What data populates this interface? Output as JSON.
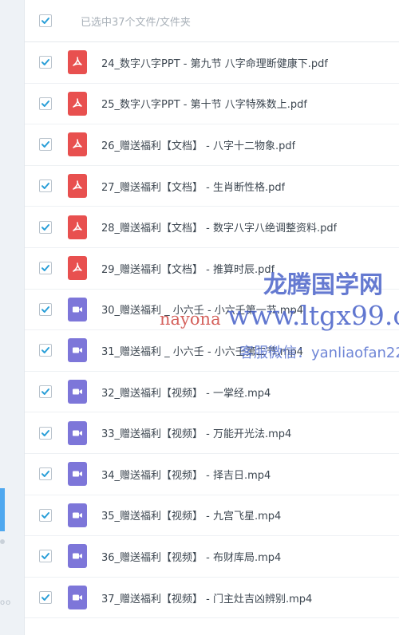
{
  "header": {
    "selection_text": "已选中37个文件/文件夹"
  },
  "files": [
    {
      "type": "pdf",
      "name": "24_数字八字PPT - 第九节 八字命理断健康下.pdf"
    },
    {
      "type": "pdf",
      "name": "25_数字八字PPT - 第十节 八字特殊数上.pdf"
    },
    {
      "type": "pdf",
      "name": "26_赠送福利【文档】 - 八字十二物象.pdf"
    },
    {
      "type": "pdf",
      "name": "27_赠送福利【文档】 - 生肖断性格.pdf"
    },
    {
      "type": "pdf",
      "name": "28_赠送福利【文档】 - 数字八字八绝调整资料.pdf"
    },
    {
      "type": "pdf",
      "name": "29_赠送福利【文档】 - 推算时辰.pdf"
    },
    {
      "type": "video",
      "name": "30_赠送福利 _ 小六壬 - 小六壬第一节.mp4"
    },
    {
      "type": "video",
      "name": "31_赠送福利 _ 小六壬 - 小六壬第二节.mp4"
    },
    {
      "type": "video",
      "name": "32_赠送福利【视频】 - 一掌经.mp4"
    },
    {
      "type": "video",
      "name": "33_赠送福利【视频】 - 万能开光法.mp4"
    },
    {
      "type": "video",
      "name": "34_赠送福利【视频】 - 择吉日.mp4"
    },
    {
      "type": "video",
      "name": "35_赠送福利【视频】 - 九宫飞星.mp4"
    },
    {
      "type": "video",
      "name": "36_赠送福利【视频】 - 布财库局.mp4"
    },
    {
      "type": "video",
      "name": "37_赠送福利【视频】 - 门主灶吉凶辨别.mp4"
    }
  ],
  "watermark": {
    "brand": "龙腾国学网",
    "site_a": "nayona",
    "site_b": "www.ltgx99.com",
    "contact": "客服微信：yanliaofan22"
  },
  "colors": {
    "check": "#2a9fd8",
    "pdf_icon": "#e8504f",
    "video_icon": "#7d76d9",
    "left_accent": "#4fa8ef"
  },
  "icons": {
    "checkbox": "checkmark-icon",
    "pdf": "pdf-file-icon",
    "video": "video-file-icon"
  }
}
